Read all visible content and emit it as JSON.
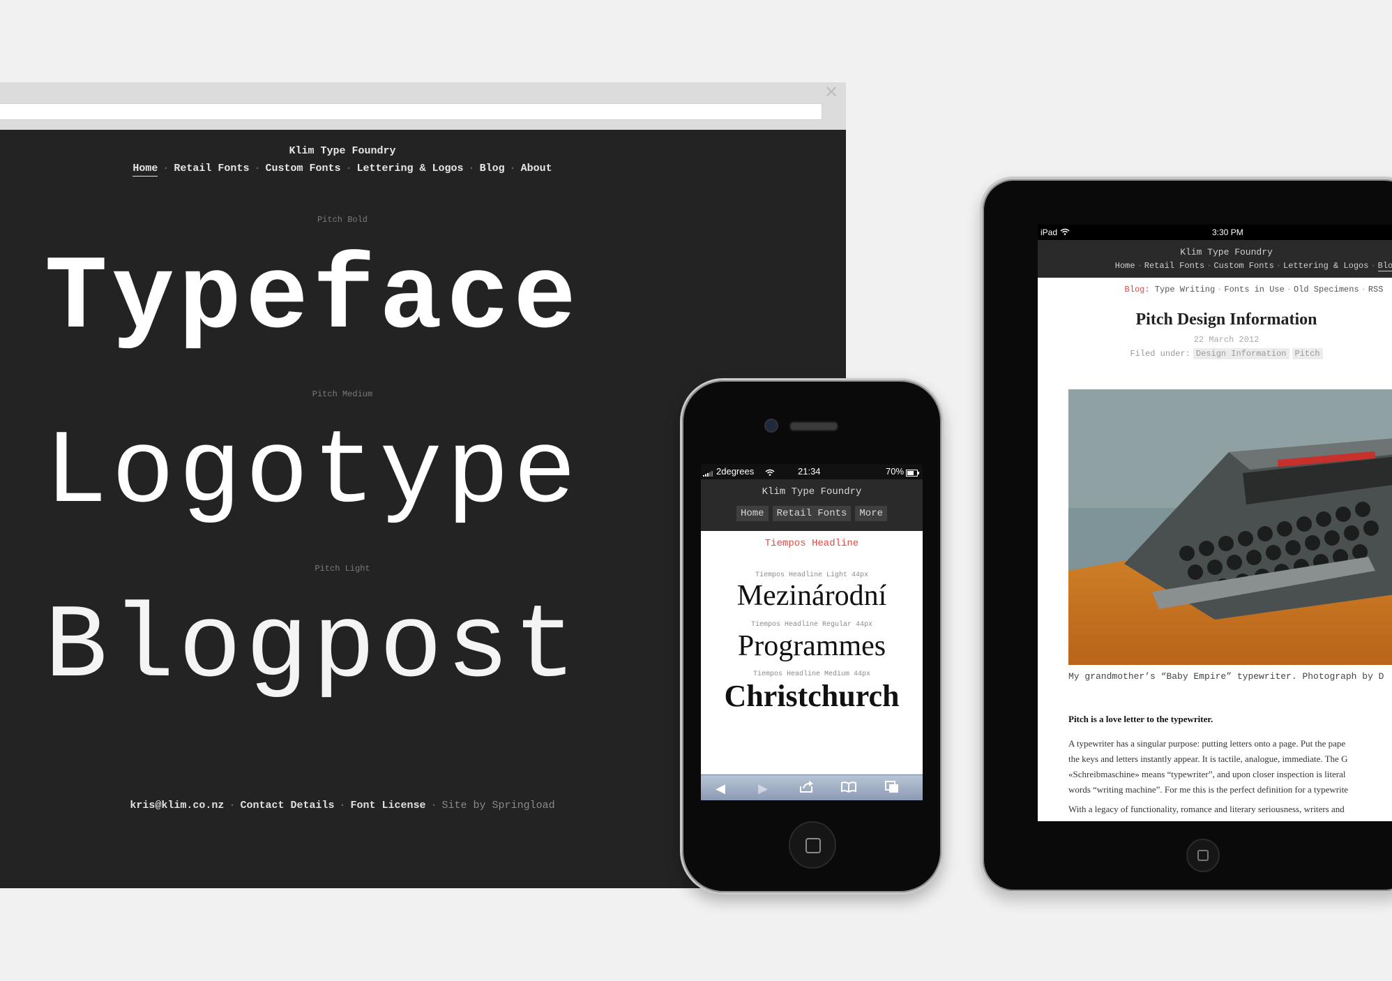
{
  "desktop": {
    "close_glyph": "✕",
    "site_title": "Klim Type Foundry",
    "nav": [
      "Home",
      "Retail Fonts",
      "Custom Fonts",
      "Lettering & Logos",
      "Blog",
      "About"
    ],
    "specimens": [
      {
        "label": "Pitch Bold",
        "word": "Typeface"
      },
      {
        "label": "Pitch Medium",
        "word": "Logotype"
      },
      {
        "label": "Pitch Light",
        "word": "Blogpost"
      }
    ],
    "footer": {
      "email": "kris@klim.co.nz",
      "contact": "Contact Details",
      "license": "Font License",
      "credit": "Site by Springload"
    }
  },
  "phone": {
    "status": {
      "carrier": "2degrees",
      "time": "21:34",
      "battery": "70%"
    },
    "site_title": "Klim Type Foundry",
    "nav": [
      "Home",
      "Retail Fonts",
      "More"
    ],
    "heading": "Tiempos Headline",
    "specimens": [
      {
        "label": "Tiempos Headline Light 44px",
        "word": "Mezinárodní"
      },
      {
        "label": "Tiempos Headline Regular 44px",
        "word": "Programmes"
      },
      {
        "label": "Tiempos Headline Medium 44px",
        "word": "Christchurch"
      }
    ],
    "toolbar": {
      "back": "◀",
      "forward": "▶",
      "share": "⇪",
      "bookmarks": "📖",
      "tabs": "⧉"
    }
  },
  "tablet": {
    "status": {
      "device": "iPad",
      "time": "3:30 PM"
    },
    "site_title": "Klim Type Foundry",
    "nav": [
      "Home",
      "Retail Fonts",
      "Custom Fonts",
      "Lettering & Logos",
      "Blo"
    ],
    "blog_nav": {
      "label": "Blog:",
      "items": [
        "Type Writing",
        "Fonts in Use",
        "Old Specimens",
        "RSS"
      ]
    },
    "post": {
      "title": "Pitch Design Information",
      "date": "22 March 2012",
      "filed_label": "Filed under:",
      "tags": [
        "Design Information",
        "Pitch"
      ],
      "caption": "My grandmother’s “Baby Empire” typewriter. Photograph by D",
      "lead": "Pitch is a love letter to the typewriter.",
      "body": [
        "A typewriter has a singular purpose: putting letters onto a page. Put the pape",
        "the keys and letters instantly appear. It is tactile, analogue, immediate. The G",
        "«Schreibmaschine» means “typewriter”, and upon closer inspection is literal",
        "words “writing machine”. For me this is the perfect definition for a typewrite"
      ],
      "body2": "With a legacy of functionality, romance and literary seriousness, writers and"
    }
  },
  "colors": {
    "accent_red": "#e8453c",
    "site_dark": "#232323",
    "background": "#f1f1f1"
  }
}
